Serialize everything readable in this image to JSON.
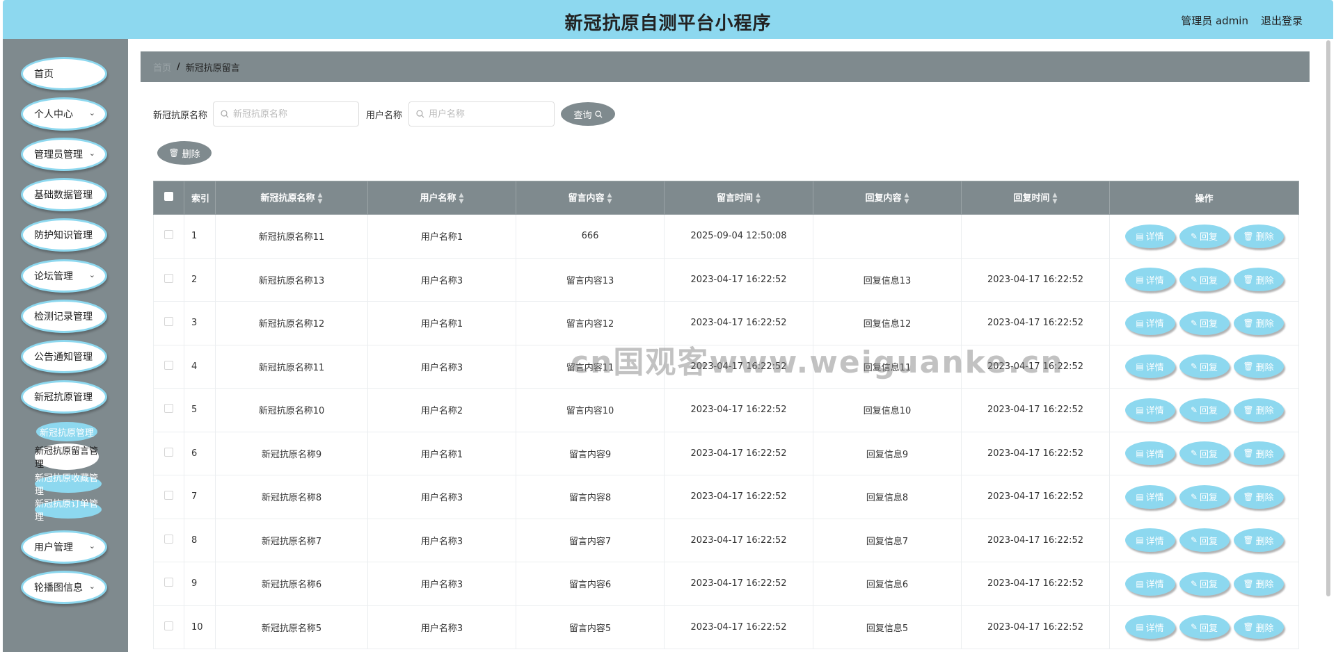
{
  "header": {
    "title": "新冠抗原自测平台小程序",
    "user": "管理员 admin",
    "logout": "退出登录"
  },
  "sidebar": {
    "items": [
      {
        "label": "首页",
        "has_children": false
      },
      {
        "label": "个人中心",
        "has_children": true
      },
      {
        "label": "管理员管理",
        "has_children": true
      },
      {
        "label": "基础数据管理",
        "has_children": true
      },
      {
        "label": "防护知识管理",
        "has_children": true
      },
      {
        "label": "论坛管理",
        "has_children": true
      },
      {
        "label": "检测记录管理",
        "has_children": true
      },
      {
        "label": "公告通知管理",
        "has_children": true
      },
      {
        "label": "新冠抗原管理",
        "has_children": true
      },
      {
        "label": "用户管理",
        "has_children": true
      },
      {
        "label": "轮播图信息",
        "has_children": true
      }
    ],
    "sub_items": [
      {
        "label": "新冠抗原管理",
        "state": "active"
      },
      {
        "label": "新冠抗原留言管理",
        "state": "current"
      },
      {
        "label": "新冠抗原收藏管理",
        "state": "normal"
      },
      {
        "label": "新冠抗原订单管理",
        "state": "normal"
      }
    ]
  },
  "breadcrumb": {
    "home": "首页",
    "separator": "/",
    "current": "新冠抗原留言"
  },
  "search": {
    "name_label": "新冠抗原名称",
    "name_placeholder": "新冠抗原名称",
    "user_label": "用户名称",
    "user_placeholder": "用户名称",
    "query_label": "查询"
  },
  "toolbar": {
    "delete_label": "删除"
  },
  "table": {
    "columns": [
      "索引",
      "新冠抗原名称",
      "用户名称",
      "留言内容",
      "留言时间",
      "回复内容",
      "回复时间",
      "操作"
    ],
    "rows": [
      [
        "1",
        "新冠抗原名称11",
        "用户名称1",
        "666",
        "2025-09-04 12:50:08",
        "",
        ""
      ],
      [
        "2",
        "新冠抗原名称13",
        "用户名称3",
        "留言内容13",
        "2023-04-17 16:22:52",
        "回复信息13",
        "2023-04-17 16:22:52"
      ],
      [
        "3",
        "新冠抗原名称12",
        "用户名称1",
        "留言内容12",
        "2023-04-17 16:22:52",
        "回复信息12",
        "2023-04-17 16:22:52"
      ],
      [
        "4",
        "新冠抗原名称11",
        "用户名称3",
        "留言内容11",
        "2023-04-17 16:22:52",
        "回复信息11",
        "2023-04-17 16:22:52"
      ],
      [
        "5",
        "新冠抗原名称10",
        "用户名称2",
        "留言内容10",
        "2023-04-17 16:22:52",
        "回复信息10",
        "2023-04-17 16:22:52"
      ],
      [
        "6",
        "新冠抗原名称9",
        "用户名称1",
        "留言内容9",
        "2023-04-17 16:22:52",
        "回复信息9",
        "2023-04-17 16:22:52"
      ],
      [
        "7",
        "新冠抗原名称8",
        "用户名称3",
        "留言内容8",
        "2023-04-17 16:22:52",
        "回复信息8",
        "2023-04-17 16:22:52"
      ],
      [
        "8",
        "新冠抗原名称7",
        "用户名称3",
        "留言内容7",
        "2023-04-17 16:22:52",
        "回复信息7",
        "2023-04-17 16:22:52"
      ],
      [
        "9",
        "新冠抗原名称6",
        "用户名称3",
        "留言内容6",
        "2023-04-17 16:22:52",
        "回复信息6",
        "2023-04-17 16:22:52"
      ],
      [
        "10",
        "新冠抗原名称5",
        "用户名称3",
        "留言内容5",
        "2023-04-17 16:22:52",
        "回复信息5",
        "2023-04-17 16:22:52"
      ]
    ],
    "actions": {
      "detail": "详情",
      "reply": "回复",
      "delete": "删除"
    }
  },
  "watermark": "cn国观客www.weiguanke.cn",
  "colors": {
    "accent": "#8dd8ef",
    "gray": "#7f8a8e"
  }
}
